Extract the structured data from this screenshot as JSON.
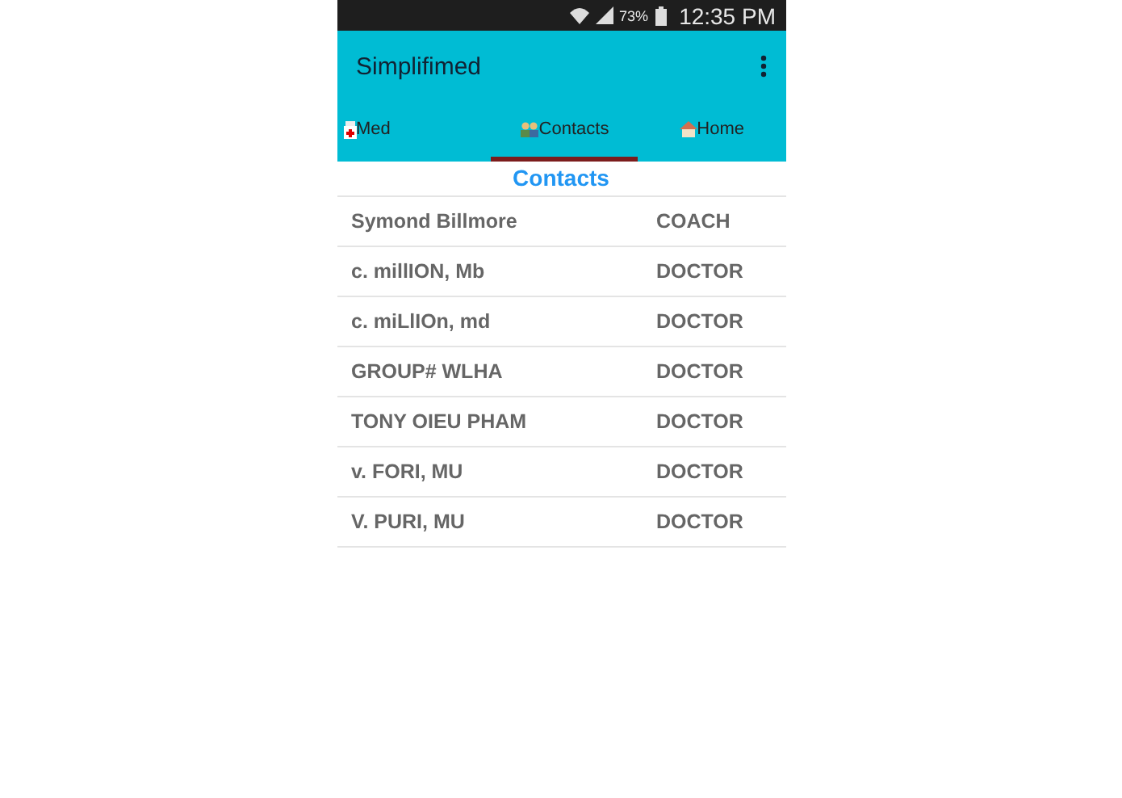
{
  "status_bar": {
    "battery_percent": "73%",
    "time": "12:35 PM"
  },
  "app_bar": {
    "title": "Simplifimed"
  },
  "tabs": [
    {
      "label": "Med",
      "kind": "med",
      "selected": false
    },
    {
      "label": "Contacts",
      "kind": "contacts",
      "selected": true
    },
    {
      "label": "Home",
      "kind": "home",
      "selected": false
    }
  ],
  "section_title": "Contacts",
  "contacts": [
    {
      "name": "Symond Billmore",
      "role": "COACH"
    },
    {
      "name": "c. millION, Mb",
      "role": "DOCTOR"
    },
    {
      "name": "c. miLlIOn, md",
      "role": "DOCTOR"
    },
    {
      "name": "GROUP# WLHA",
      "role": "DOCTOR"
    },
    {
      "name": "TONY OIEU PHAM",
      "role": "DOCTOR"
    },
    {
      "name": "v. FORI, MU",
      "role": "DOCTOR"
    },
    {
      "name": "V. PURI, MU",
      "role": "DOCTOR"
    }
  ]
}
